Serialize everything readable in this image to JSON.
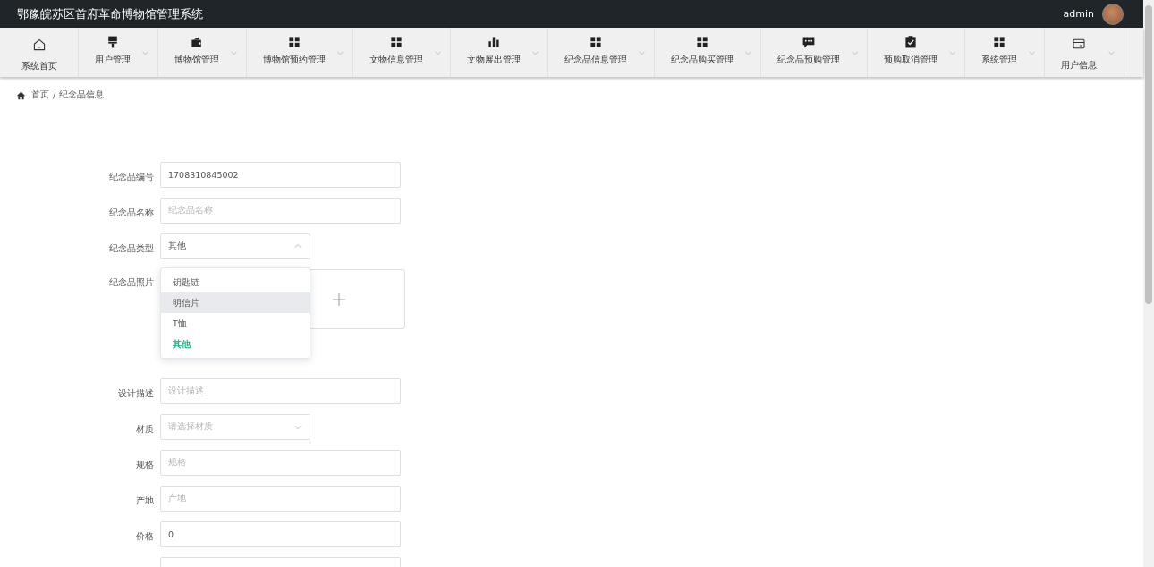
{
  "header": {
    "title": "鄂豫皖苏区首府革命博物馆管理系统",
    "user": "admin"
  },
  "nav": [
    {
      "label": "系统首页"
    },
    {
      "label": "用户管理"
    },
    {
      "label": "博物馆管理"
    },
    {
      "label": "博物馆预约管理"
    },
    {
      "label": "文物信息管理"
    },
    {
      "label": "文物展出管理"
    },
    {
      "label": "纪念品信息管理"
    },
    {
      "label": "纪念品购买管理"
    },
    {
      "label": "纪念品预购管理"
    },
    {
      "label": "预购取消管理"
    },
    {
      "label": "系统管理"
    },
    {
      "label": "用户信息"
    }
  ],
  "breadcrumb": {
    "items": [
      "首页",
      "纪念品信息"
    ],
    "separator": "/"
  },
  "form": [
    {
      "kind": "input",
      "label": "纪念品编号",
      "value": "1708310845002"
    },
    {
      "kind": "input",
      "label": "纪念品名称",
      "placeholder": "纪念品名称"
    },
    {
      "kind": "select",
      "label": "纪念品类型",
      "value": "其他",
      "expanded": true,
      "options": [
        {
          "label": "钥匙链",
          "selected": false,
          "hovered": false
        },
        {
          "label": "明信片",
          "selected": false,
          "hovered": true
        },
        {
          "label": "T恤",
          "selected": false,
          "hovered": false
        },
        {
          "label": "其他",
          "selected": true,
          "hovered": false
        }
      ]
    },
    {
      "kind": "upload",
      "label": "纪念品照片"
    },
    {
      "kind": "input",
      "label": "设计描述",
      "placeholder": "设计描述"
    },
    {
      "kind": "select",
      "label": "材质",
      "placeholder": "请选择材质",
      "expanded": false
    },
    {
      "kind": "input",
      "label": "规格",
      "placeholder": "规格"
    },
    {
      "kind": "input",
      "label": "产地",
      "placeholder": "产地"
    },
    {
      "kind": "input",
      "label": "价格",
      "value": "0"
    },
    {
      "kind": "input"
    }
  ]
}
